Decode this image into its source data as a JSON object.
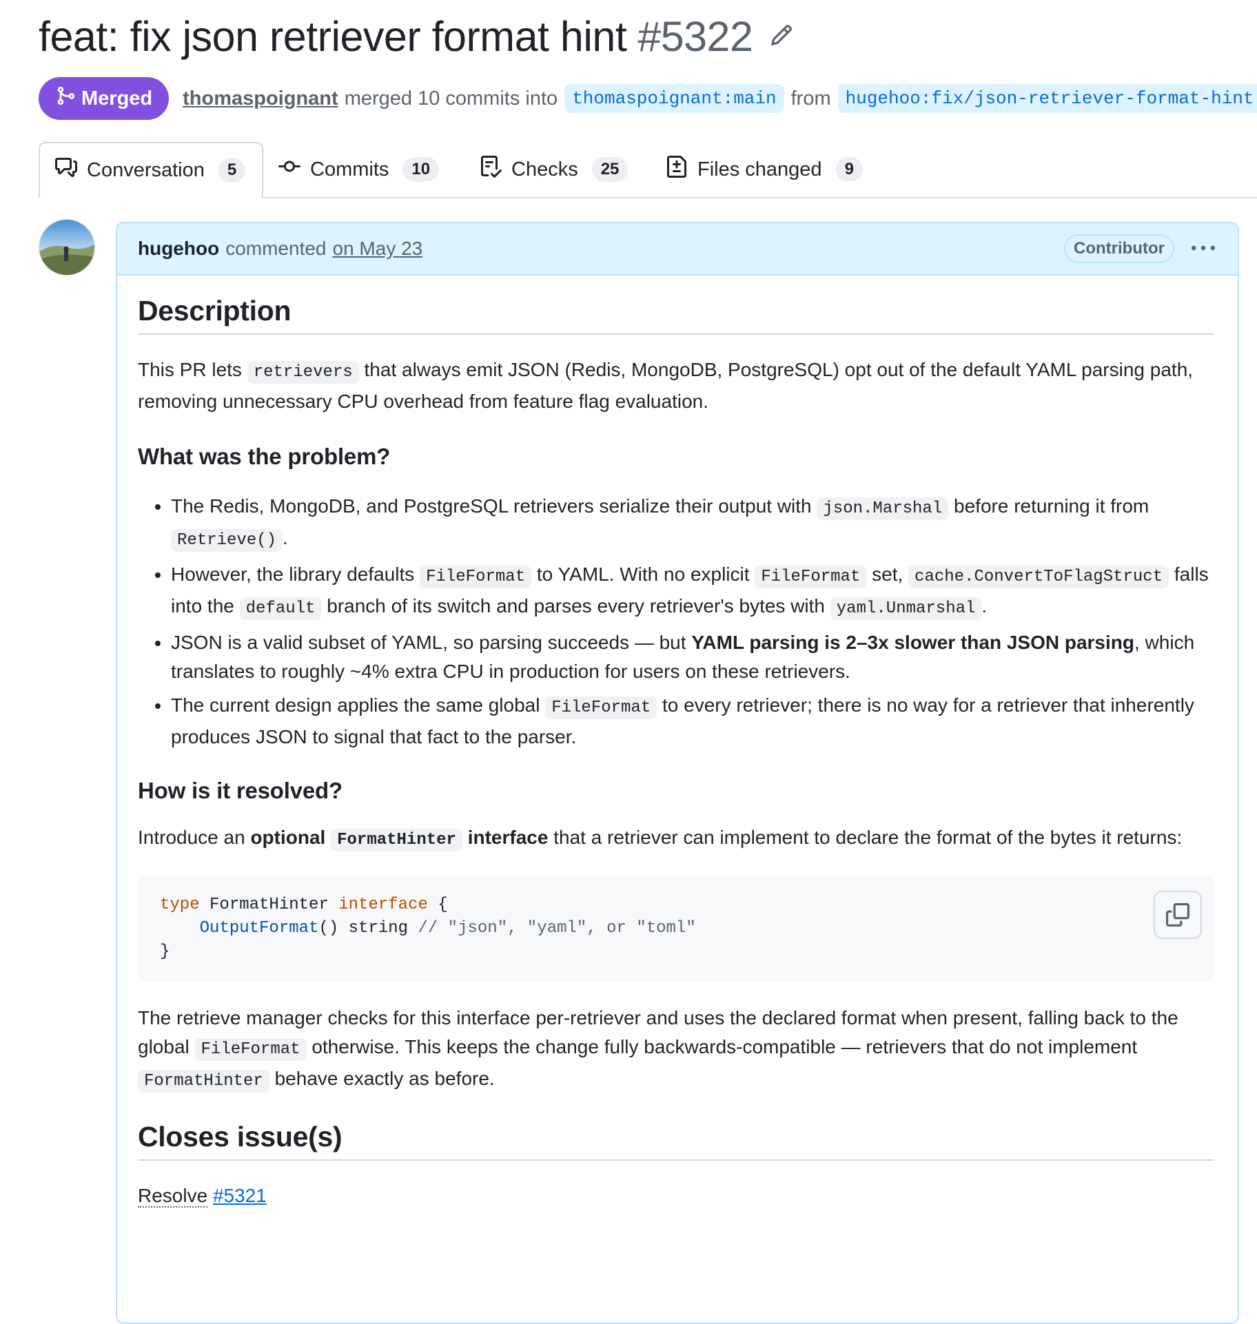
{
  "pr": {
    "title": "feat: fix json retriever format hint",
    "number": "#5322",
    "state": "Merged",
    "merged_by": "thomaspoignant",
    "merge_text": "merged 10 commits into",
    "base_branch": "thomaspoignant:main",
    "from_text": "from",
    "head_branch": "hugehoo:fix/json-retriever-format-hint"
  },
  "tabs": [
    {
      "label": "Conversation",
      "count": "5"
    },
    {
      "label": "Commits",
      "count": "10"
    },
    {
      "label": "Checks",
      "count": "25"
    },
    {
      "label": "Files changed",
      "count": "9"
    }
  ],
  "comment": {
    "author": "hugehoo",
    "verb": "commented",
    "time": "on May 23",
    "role": "Contributor",
    "description_heading": "Description",
    "desc_p1_a": "This PR lets",
    "desc_p1_code": "retrievers",
    "desc_p1_b": "that always emit JSON (Redis, MongoDB, PostgreSQL) opt out of the default YAML parsing path, removing unnecessary CPU overhead from feature flag evaluation.",
    "problem_heading": "What was the problem?",
    "problem_items": {
      "i1_a": "The Redis, MongoDB, and PostgreSQL retrievers serialize their output with",
      "i1_code1": "json.Marshal",
      "i1_b": "before returning it from",
      "i1_code2": "Retrieve()",
      "i1_c": ".",
      "i2_a": "However, the library defaults",
      "i2_code1": "FileFormat",
      "i2_b": "to YAML. With no explicit",
      "i2_code2": "FileFormat",
      "i2_c": "set,",
      "i2_code3": "cache.ConvertToFlagStruct",
      "i2_d": "falls into the",
      "i2_code4": "default",
      "i2_e": "branch of its switch and parses every retriever's bytes with",
      "i2_code5": "yaml.Unmarshal",
      "i2_f": ".",
      "i3_a": "JSON is a valid subset of YAML, so parsing succeeds — but",
      "i3_bold": "YAML parsing is 2–3x slower than JSON parsing",
      "i3_b": ", which translates to roughly ~4% extra CPU in production for users on these retrievers.",
      "i4_a": "The current design applies the same global",
      "i4_code": "FileFormat",
      "i4_b": "to every retriever; there is no way for a retriever that inherently produces JSON to signal that fact to the parser."
    },
    "resolved_heading": "How is it resolved?",
    "res_p1_a": "Introduce an",
    "res_p1_bold1": "optional",
    "res_p1_code": "FormatHinter",
    "res_p1_bold2": "interface",
    "res_p1_b": "that a retriever can implement to declare the format of the bytes it returns:",
    "code": {
      "l1_kw": "type",
      "l1_name": " FormatHinter ",
      "l1_kw2": "interface",
      "l1_rest": " {",
      "l2_indent": "    ",
      "l2_fn": "OutputFormat",
      "l2_rest": "() string ",
      "l2_cm": "// \"json\", \"yaml\", or \"toml\"",
      "l3": "}"
    },
    "res_p2_a": "The retrieve manager checks for this interface per-retriever and uses the declared format when present, falling back to the global",
    "res_p2_code1": "FileFormat",
    "res_p2_b": "otherwise. This keeps the change fully backwards-compatible — retrievers that do not implement",
    "res_p2_code2": "FormatHinter",
    "res_p2_c": "behave exactly as before.",
    "closes_heading": "Closes issue(s)",
    "resolve_text": "Resolve",
    "resolve_link": "#5321"
  },
  "colors": {
    "merged": "#8250df",
    "link": "#0969da",
    "header_bg": "#ddf4ff"
  }
}
